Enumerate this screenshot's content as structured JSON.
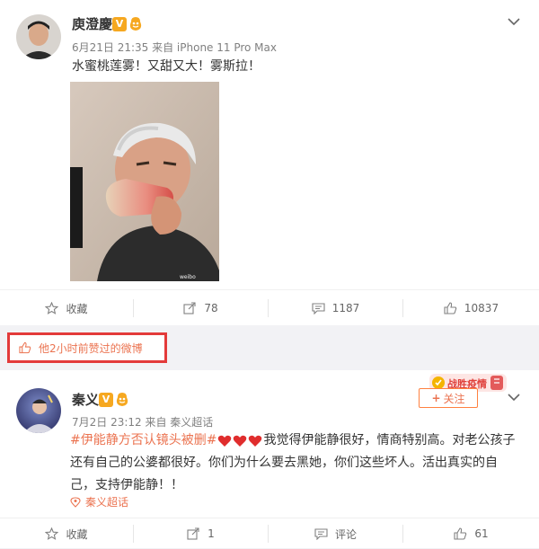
{
  "post1": {
    "username": "庾澄慶",
    "verify_badge": "V",
    "meta": "6月21日 21:35 来自 iPhone 11 Pro Max",
    "text": "水蜜桃莲雾！又甜又大！雾斯拉！",
    "actions": {
      "collect": "收藏",
      "repost": "78",
      "comment": "1187",
      "like": "10837"
    }
  },
  "liked_notice": "他2小时前赞过的微博",
  "post2": {
    "username": "秦义",
    "verify_badge": "V",
    "meta": "7月2日 23:12 来自 秦义超话",
    "topic": "#伊能静方否认镜头被删#",
    "text_line1": "我觉得伊能静很好，情商特别高。对老公孩子",
    "text_line2": "还有自己的公婆都很好。你们为什么要去黑她，你们这些坏人。活出真实的自",
    "text_line3": "己，支持伊能静！！",
    "supertopic": "秦义超话",
    "follow_label": "关注",
    "banner_text": "战胜疫情",
    "actions": {
      "collect": "收藏",
      "repost": "1",
      "comment": "评论",
      "like": "61"
    }
  },
  "colors": {
    "accent": "#eb7350",
    "verify": "#f6a820",
    "highlight_border": "#e33a3a",
    "heart": "#e02d2d"
  }
}
